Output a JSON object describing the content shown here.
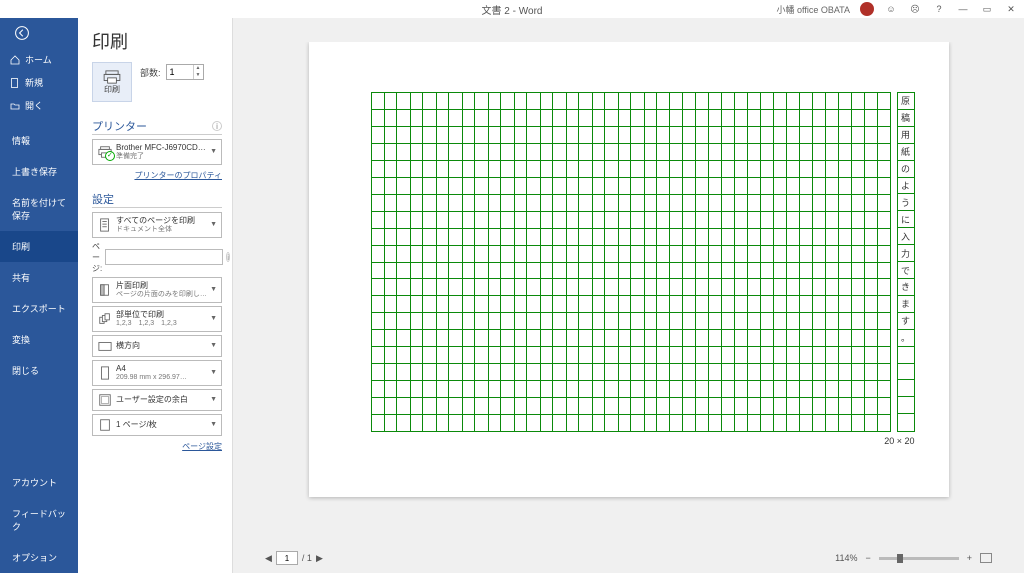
{
  "title": "文書 2  -  Word",
  "user": {
    "name": "小幡 office OBATA"
  },
  "rail": {
    "home": "ホーム",
    "new": "新規",
    "open": "開く",
    "info": "情報",
    "saveover": "上書き保存",
    "saveas": "名前を付けて保存",
    "print": "印刷",
    "share": "共有",
    "export": "エクスポート",
    "transform": "変換",
    "close": "閉じる",
    "account": "アカウント",
    "feedback": "フィードバック",
    "options": "オプション"
  },
  "panel": {
    "heading": "印刷",
    "print_btn": "印刷",
    "copies_label": "部数:",
    "copies_value": "1",
    "printer_title": "プリンター",
    "printer_name": "Brother MFC-J6970CD…",
    "printer_status": "準備完了",
    "printer_props": "プリンターのプロパティ",
    "settings_title": "設定",
    "pages_all": "すべてのページを印刷",
    "pages_all_sub": "ドキュメント全体",
    "page_label": "ページ:",
    "page_value": "",
    "side": "片面印刷",
    "side_sub": "ページの片面のみを印刷し…",
    "collate": "部単位で印刷",
    "collate_sub": "1,2,3　1,2,3　1,2,3",
    "orient": "横方向",
    "paper": "A4",
    "paper_sub": "209.98 mm x 296.97…",
    "margins": "ユーザー設定の余白",
    "perpage": "1 ページ/枚",
    "page_setup": "ページ設定"
  },
  "preview": {
    "text_chars": [
      "原",
      "稿",
      "用",
      "紙",
      "の",
      "よ",
      "う",
      "に",
      "入",
      "力",
      "で",
      "き",
      "ま",
      "す",
      "。"
    ],
    "grid_label": "20 × 20",
    "current_page": "1",
    "total_pages": "/ 1",
    "zoom": "114%"
  }
}
